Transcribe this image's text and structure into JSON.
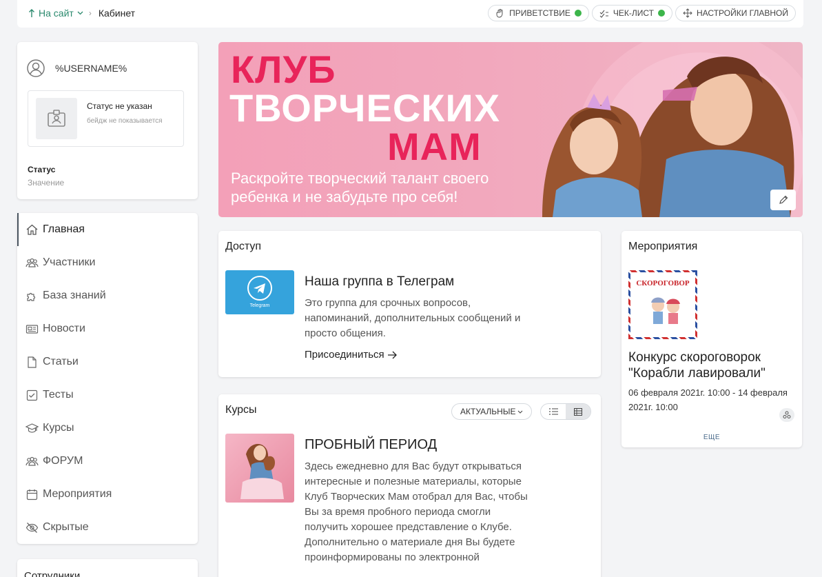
{
  "breadcrumb": {
    "site": "На сайт",
    "current": "Кабинет"
  },
  "top_buttons": {
    "greeting": "ПРИВЕТСТВИЕ",
    "checklist": "ЧЕК-ЛИСТ",
    "settings": "НАСТРОЙКИ ГЛАВНОЙ"
  },
  "profile": {
    "username": "%USERNAME%",
    "badge_title": "Статус не указан",
    "badge_sub": "бейдж не показывается",
    "status_label": "Статус",
    "status_value": "Значение"
  },
  "nav": {
    "items": [
      {
        "label": "Главная",
        "icon": "home-icon"
      },
      {
        "label": "Участники",
        "icon": "users-icon"
      },
      {
        "label": "База знаний",
        "icon": "puzzle-icon"
      },
      {
        "label": "Новости",
        "icon": "news-icon"
      },
      {
        "label": "Статьи",
        "icon": "document-icon"
      },
      {
        "label": "Тесты",
        "icon": "checkbox-icon"
      },
      {
        "label": "Курсы",
        "icon": "graduation-cap-icon"
      },
      {
        "label": "ФОРУМ",
        "icon": "forum-icon"
      },
      {
        "label": "Мероприятия",
        "icon": "calendar-icon"
      },
      {
        "label": "Скрытые",
        "icon": "eye-off-icon"
      }
    ]
  },
  "staff_title": "Сотрудники",
  "banner": {
    "line1": "КЛУБ",
    "line2": "ТВОРЧЕСКИХ",
    "line3": "МАМ",
    "subtitle": "Раскройте творческий талант своего ребенка и не забудьте про себя!"
  },
  "access": {
    "title": "Доступ",
    "item_title": "Наша группа в Телеграм",
    "item_desc": "Это группа для срочных вопросов, напоминаний, дополнительных сообщений и просто общения.",
    "join": "Присоединиться",
    "image_caption": "Telegram"
  },
  "courses": {
    "title": "Курсы",
    "filter": "АКТУАЛЬНЫЕ",
    "item_title": "ПРОБНЫЙ ПЕРИОД",
    "item_desc": "Здесь ежедневно для Вас будут открываться интересные и полезные материалы, которые Клуб Творческих Мам отобрал для Вас, чтобы Вы за время пробного периода смогли получить хорошее представление о Клубе. Дополнительно о материале дня Вы будете проинформированы по электронной"
  },
  "events": {
    "title": "Мероприятия",
    "image_caption": "СКОРОГОВОР",
    "item_title": "Конкурс скороговорок \"Корабли лавировали\"",
    "item_date": "06 февраля 2021г. 10:00 - 14 февраля 2021г. 10:00",
    "more": "ЕЩЕ"
  },
  "colors": {
    "accent_green": "#2b8a6e",
    "status_dot": "#3cb54a",
    "banner_pink": "#e8245a",
    "telegram_blue": "#35a3dc"
  }
}
